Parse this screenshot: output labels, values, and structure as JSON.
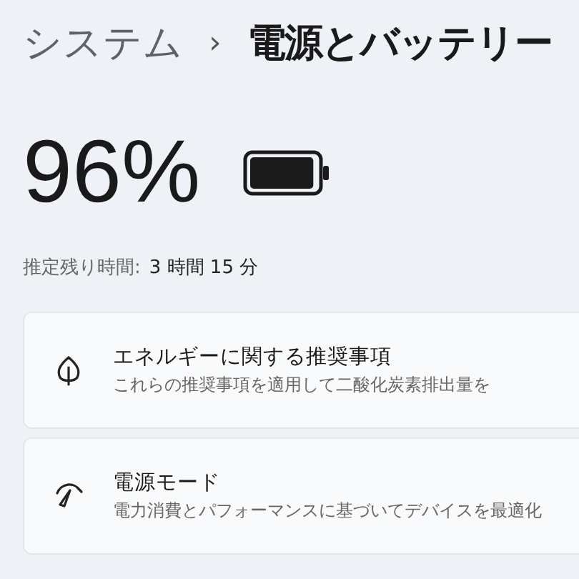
{
  "breadcrumb": {
    "parent": "システム",
    "separator": "›",
    "current": "電源とバッテリー"
  },
  "battery": {
    "percent": "96%",
    "level": 0.96,
    "estimate_label": "推定残り時間:",
    "estimate_value": "3 時間 15 分"
  },
  "cards": [
    {
      "kind": "leaf",
      "title": "エネルギーに関する推奨事項",
      "description": "これらの推奨事項を適用して二酸化炭素排出量を"
    },
    {
      "kind": "gauge",
      "title": "電源モード",
      "description": "電力消費とパフォーマンスに基づいてデバイスを最適化"
    }
  ]
}
